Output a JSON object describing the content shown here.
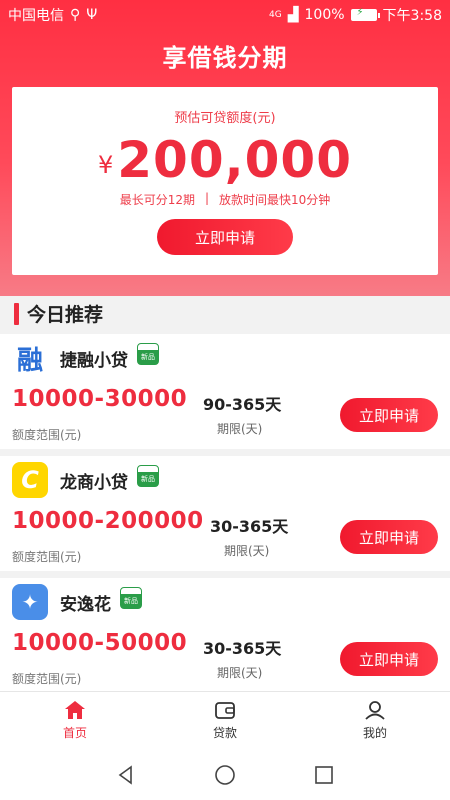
{
  "status": {
    "carrier": "中国电信",
    "network": "4G",
    "battery": "100%",
    "time": "下午3:58"
  },
  "app": {
    "title": "享借钱分期"
  },
  "quota": {
    "label": "预估可贷额度(元)",
    "currency": "¥",
    "amount": "200,000",
    "term_note": "最长可分12期",
    "separator": "|",
    "speed_note": "放款时间最快10分钟",
    "apply_label": "立即申请"
  },
  "section": {
    "title": "今日推荐"
  },
  "loans": [
    {
      "name": "捷融小贷",
      "tag": "新品",
      "range": "10000-30000",
      "range_label": "额度范围(元)",
      "term": "90-365天",
      "term_label": "期限(天)",
      "apply_label": "立即申请",
      "logo_char": "融",
      "logo_bg": "#ffffff",
      "logo_color": "#2b6fd6"
    },
    {
      "name": "龙商小贷",
      "tag": "新品",
      "range": "10000-200000",
      "range_label": "额度范围(元)",
      "term": "30-365天",
      "term_label": "期限(天)",
      "apply_label": "立即申请",
      "logo_char": "C",
      "logo_bg": "#ffd600",
      "logo_color": "#ffffff"
    },
    {
      "name": "安逸花",
      "tag": "新品",
      "range": "10000-50000",
      "range_label": "额度范围(元)",
      "term": "30-365天",
      "term_label": "期限(天)",
      "apply_label": "立即申请",
      "logo_char": "✦",
      "logo_bg": "#4a8ee8",
      "logo_color": "#ffffff"
    }
  ],
  "nav": [
    {
      "label": "首页",
      "icon": "home-icon",
      "active": true
    },
    {
      "label": "贷款",
      "icon": "wallet-icon",
      "active": false
    },
    {
      "label": "我的",
      "icon": "user-icon",
      "active": false
    }
  ],
  "colors": {
    "accent": "#ee2d3f",
    "tag_green": "#2a9d48"
  }
}
